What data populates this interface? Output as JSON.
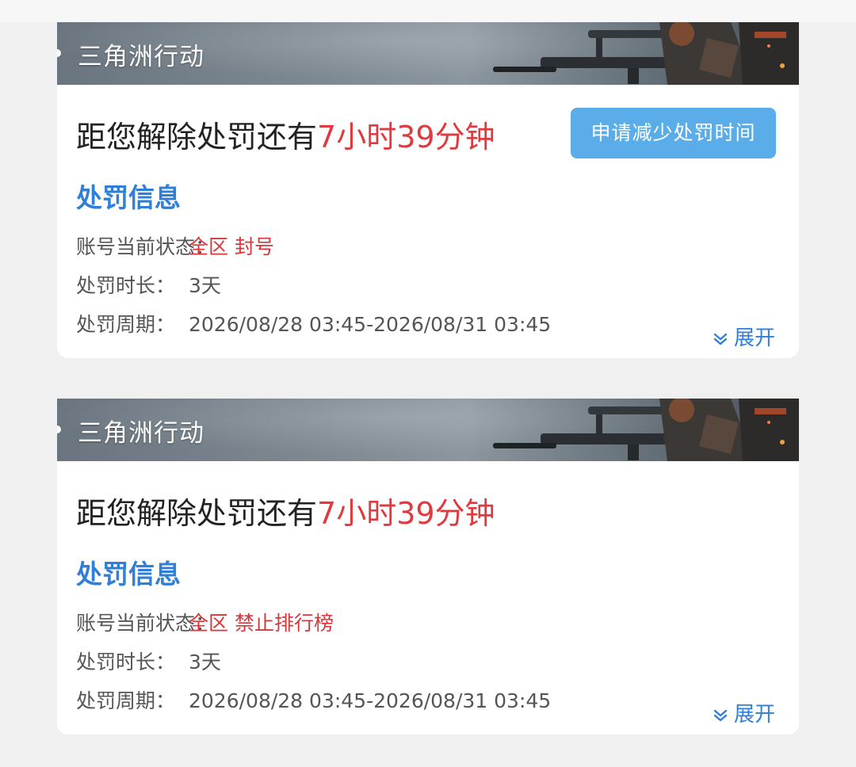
{
  "cards": [
    {
      "game_name": "三角洲行动",
      "headline_prefix": "距您解除处罚还有",
      "remaining_time": "7小时39分钟",
      "reduce_button_label": "申请减少处罚时间",
      "section_title": "处罚信息",
      "status_label": "账号当前状态：",
      "status_value": "全区 封号",
      "duration_label": "处罚时长：",
      "duration_value": "3天",
      "period_label": "处罚周期：",
      "period_value": "2026/08/28 03:45-2026/08/31 03:45",
      "expand_label": "展开"
    },
    {
      "game_name": "三角洲行动",
      "headline_prefix": "距您解除处罚还有",
      "remaining_time": "7小时39分钟",
      "section_title": "处罚信息",
      "status_label": "账号当前状态：",
      "status_value": "全区 禁止排行榜",
      "duration_label": "处罚时长：",
      "duration_value": "3天",
      "period_label": "处罚周期：",
      "period_value": "2026/08/28 03:45-2026/08/31 03:45",
      "expand_label": "展开"
    }
  ],
  "icons": {
    "expand": "chevron-double-down-icon",
    "banner_dot": "bullet-dot-icon"
  },
  "colors": {
    "accent_blue": "#2f7fd8",
    "button_blue": "#5aade8",
    "alert_red": "#e0393e"
  }
}
